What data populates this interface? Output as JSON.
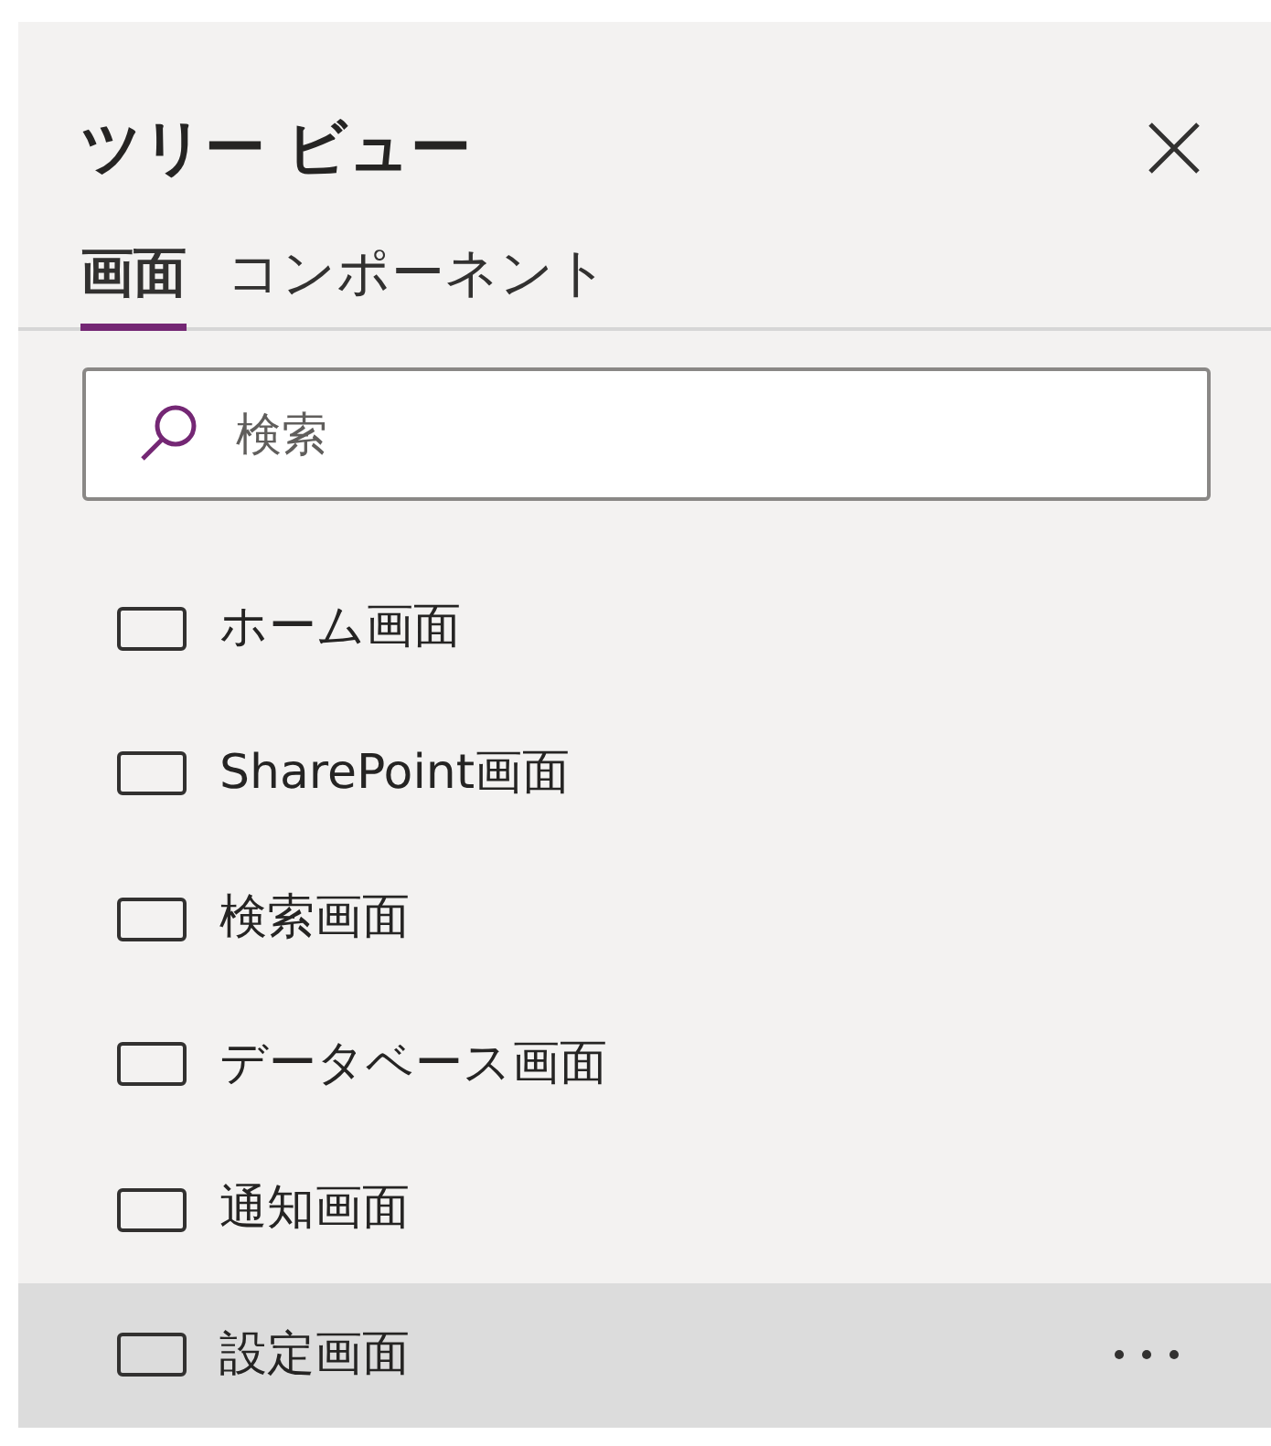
{
  "panel": {
    "title": "ツリー ビュー"
  },
  "tabs": [
    {
      "label": "画面",
      "selected": true
    },
    {
      "label": "コンポーネント",
      "selected": false
    }
  ],
  "search": {
    "placeholder": "検索"
  },
  "screens": [
    {
      "label": "ホーム画面",
      "selected": false
    },
    {
      "label": "SharePoint画面",
      "selected": false
    },
    {
      "label": "検索画面",
      "selected": false
    },
    {
      "label": "データベース画面",
      "selected": false
    },
    {
      "label": "通知画面",
      "selected": false
    },
    {
      "label": "設定画面",
      "selected": true
    }
  ]
}
